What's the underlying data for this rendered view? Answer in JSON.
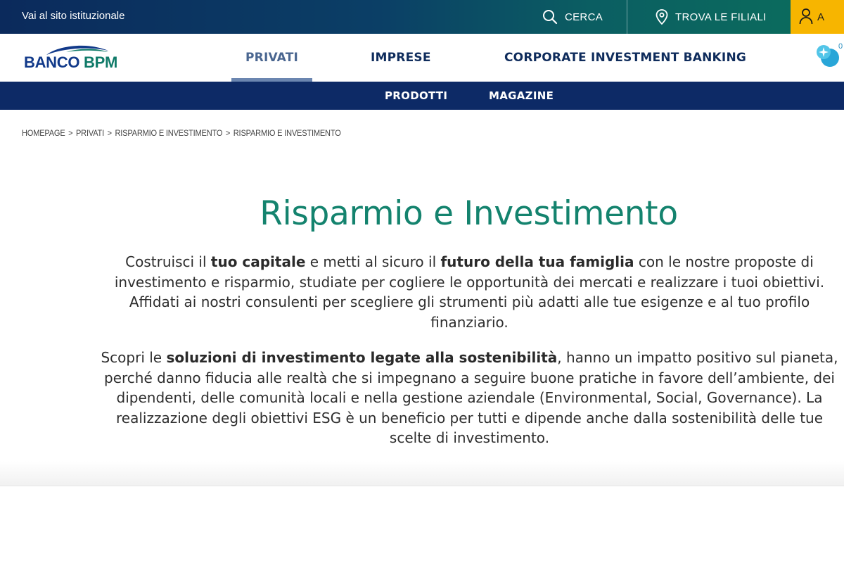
{
  "topbar": {
    "site_link": "Vai al sito istituzionale",
    "search_label": "CERCA",
    "branches_label": "TROVA LE FILIALI",
    "account_label": "A",
    "search_icon": "search-icon",
    "branches_icon": "map-pin-icon",
    "account_icon": "user-icon"
  },
  "logo": {
    "part1": "BANCO ",
    "part2": "BPM"
  },
  "mainnav": {
    "tabs": [
      {
        "label": "PRIVATI",
        "active": true
      },
      {
        "label": "IMPRESE",
        "active": false
      },
      {
        "label": "CORPORATE INVESTMENT BANKING",
        "active": false
      }
    ],
    "chatbot_count": "0"
  },
  "subnav": {
    "items": [
      {
        "label": "PRODOTTI"
      },
      {
        "label": "MAGAZINE"
      }
    ]
  },
  "breadcrumb": {
    "items": [
      {
        "label": "Homepage"
      },
      {
        "label": "Privati"
      },
      {
        "label": "Risparmio e Investimento"
      },
      {
        "label": "Risparmio e Investimento"
      }
    ],
    "separator": ">"
  },
  "hero": {
    "title": "Risparmio e Investimento",
    "p1": [
      {
        "t": "Costruisci il ",
        "b": false
      },
      {
        "t": "tuo capitale",
        "b": true
      },
      {
        "t": " e metti al sicuro il ",
        "b": false
      },
      {
        "t": "futuro della tua famiglia",
        "b": true
      },
      {
        "t": " con le nostre proposte di investimento e risparmio, studiate per cogliere le opportunità dei mercati e realizzare i tuoi obiettivi. Affidati ai nostri consulenti per scegliere gli strumenti più adatti alle tue esigenze e al tuo profilo finanziario.",
        "b": false
      }
    ],
    "p2": [
      {
        "t": "Scopri le ",
        "b": false
      },
      {
        "t": "soluzioni di investimento legate alla sostenibilità",
        "b": true
      },
      {
        "t": ", hanno un impatto positivo sul pianeta, perché danno fiducia alle realtà che si impegnano a seguire buone pratiche in favore dell’ambiente, dei dipendenti, delle comunità locali e nella gestione aziendale (Environmental, Social, Governance). La realizzazione degli obiettivi ESG è un beneficio per tutti e dipende anche dalla sostenibilità delle tue scelte di investimento.",
        "b": false
      }
    ]
  },
  "colors": {
    "topbar_start": "#0b2a5c",
    "topbar_end": "#0b6e5c",
    "account_bg": "#f7b500",
    "subnav_bg": "#0d2a66",
    "title_green": "#14836e",
    "nav_text": "#0f2c5c"
  }
}
